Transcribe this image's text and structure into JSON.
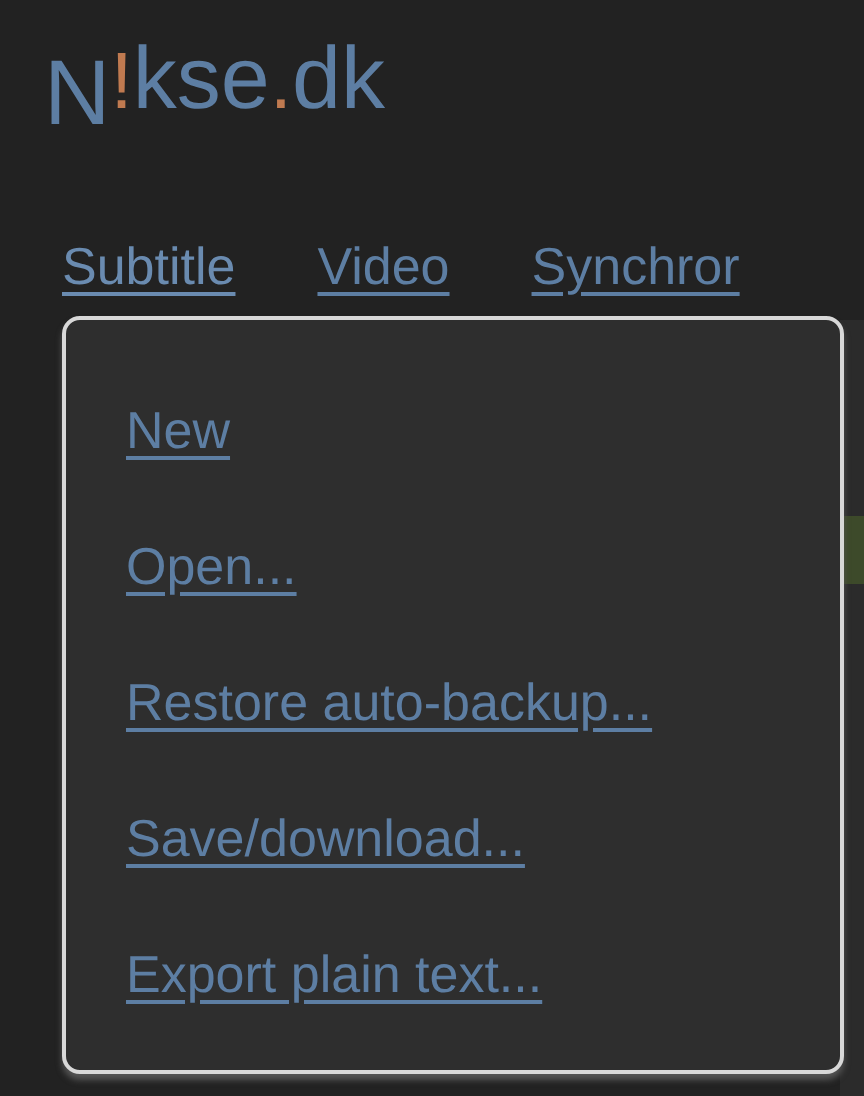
{
  "logo": {
    "parts": [
      {
        "text": "N",
        "accent": false
      },
      {
        "text": "!",
        "accent": true
      },
      {
        "text": "kse",
        "accent": false
      },
      {
        "text": ".",
        "accent": true
      },
      {
        "text": "dk",
        "accent": false
      }
    ]
  },
  "nav": [
    {
      "label": "Subtitle",
      "selected": true
    },
    {
      "label": "Video",
      "selected": false
    },
    {
      "label": "Synchror",
      "selected": false
    }
  ],
  "menu": {
    "items": [
      {
        "label": "New"
      },
      {
        "label": "Open..."
      },
      {
        "label": "Restore auto-backup..."
      },
      {
        "label": "Save/download..."
      },
      {
        "label": "Export plain text..."
      }
    ]
  }
}
